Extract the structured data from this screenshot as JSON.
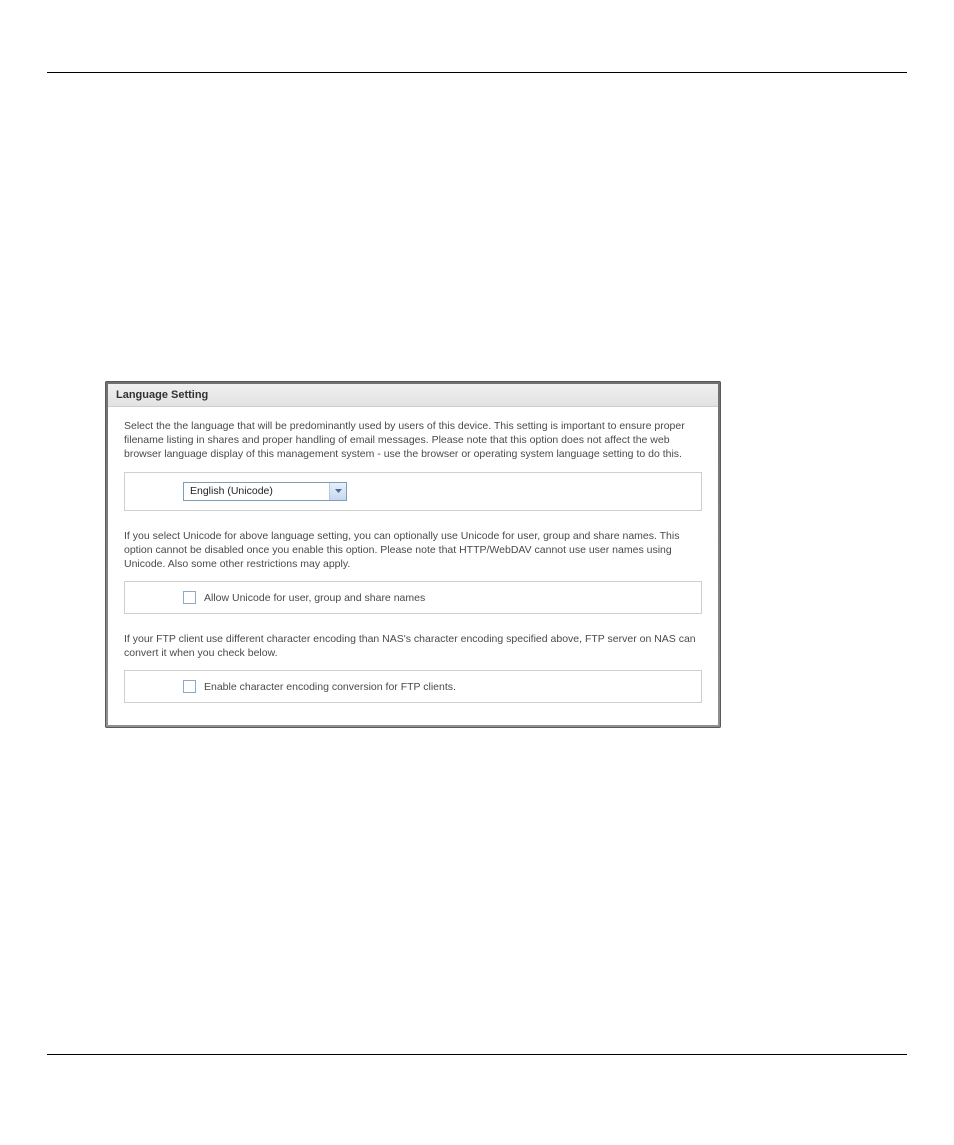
{
  "panel": {
    "title": "Language Setting",
    "desc1": "Select the the language that will be predominantly used by users of this device. This setting is important to ensure proper filename listing in shares and proper handling of email messages. Please note that this option does not affect the web browser language display of this management system - use the browser or operating system language setting to do this.",
    "language": {
      "selected": "English (Unicode)"
    },
    "desc2": "If you select Unicode for above language setting, you can optionally use Unicode for user, group and share names. This option cannot be disabled once you enable this option. Please note that HTTP/WebDAV cannot use user names using Unicode. Also some other restrictions may apply.",
    "allow_unicode_label": "Allow Unicode for user, group and share names",
    "desc3": "If your FTP client use different character encoding than NAS's character encoding specified above, FTP server on NAS can convert it when you check below.",
    "ftp_convert_label": "Enable character encoding conversion for FTP clients."
  }
}
